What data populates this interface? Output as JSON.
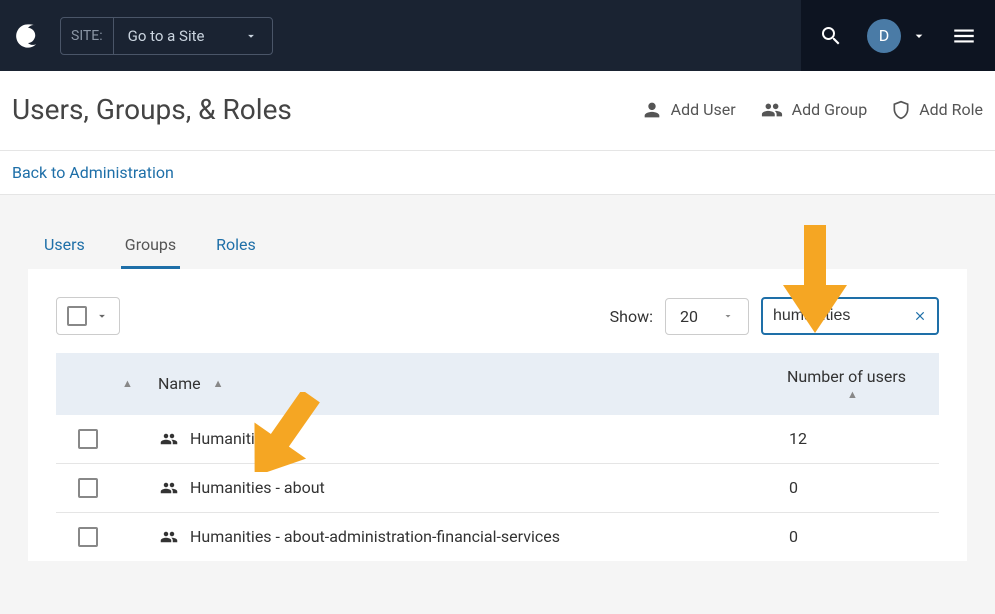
{
  "topbar": {
    "site_label": "SITE:",
    "site_dropdown": "Go to a Site",
    "avatar_letter": "D"
  },
  "page": {
    "title": "Users, Groups, & Roles",
    "back_link": "Back to Administration"
  },
  "header_actions": {
    "add_user": "Add User",
    "add_group": "Add Group",
    "add_role": "Add Role"
  },
  "tabs": {
    "users": "Users",
    "groups": "Groups",
    "roles": "Roles",
    "active": "groups"
  },
  "controls": {
    "show_label": "Show:",
    "show_value": "20",
    "search_value": "humanities"
  },
  "table": {
    "columns": {
      "name": "Name",
      "num_users": "Number of users"
    },
    "rows": [
      {
        "name": "Humanities",
        "num_users": "12"
      },
      {
        "name": "Humanities - about",
        "num_users": "0"
      },
      {
        "name": "Humanities - about-administration-financial-services",
        "num_users": "0"
      }
    ]
  }
}
